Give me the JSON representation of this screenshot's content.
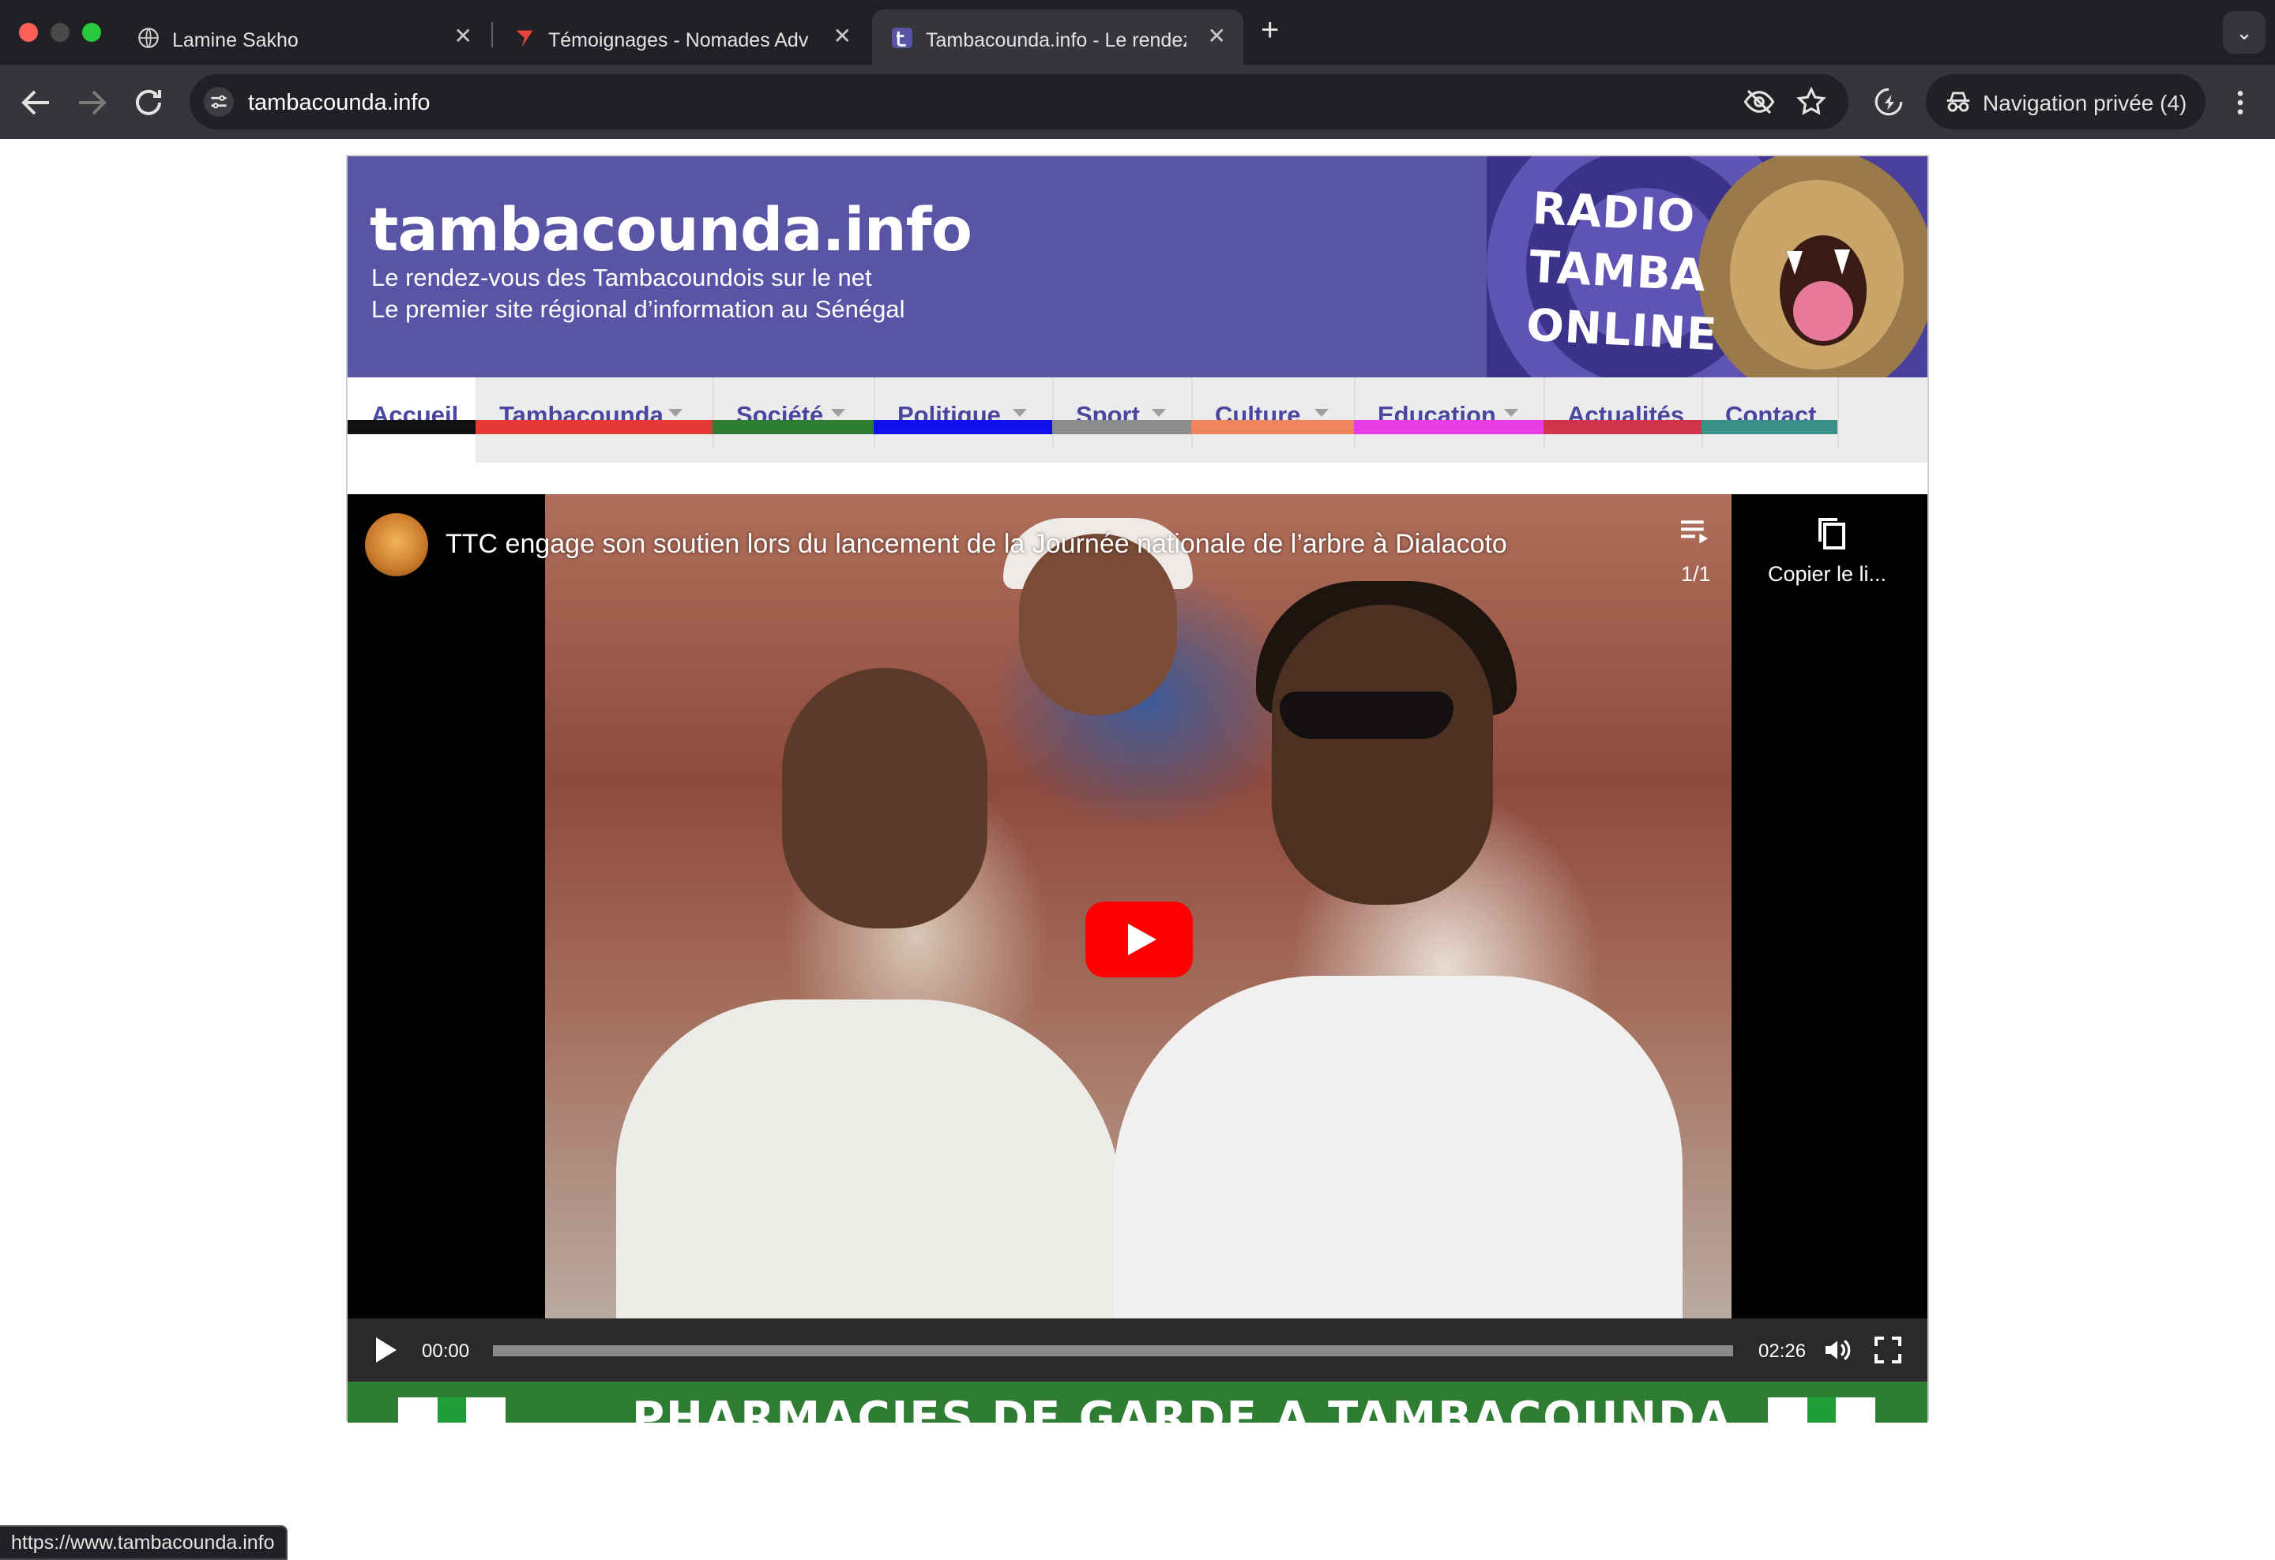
{
  "browser": {
    "tabs": [
      {
        "title": "Lamine Sakho",
        "favicon": "globe-icon",
        "active": false
      },
      {
        "title": "Témoignages - Nomades Adventure",
        "favicon": "nomades-icon",
        "active": false
      },
      {
        "title": "Tambacounda.info - Le rendez-vous des Tambacoundois",
        "favicon": "tambacounda-icon",
        "active": true
      }
    ],
    "close_glyph": "✕",
    "new_tab_glyph": "+",
    "tab_search_glyph": "⌄",
    "url": "tambacounda.info",
    "incognito_label": "Navigation privée (4)",
    "status_url": "https://www.tambacounda.info"
  },
  "site": {
    "title": "tambacounda.info",
    "tagline_1": "Le rendez-vous des Tambacoundois sur le net",
    "tagline_2": "Le premier site régional d’information au Sénégal",
    "radio_lines": [
      "RADIO",
      "TAMBA",
      "ONLINE"
    ],
    "nav": [
      {
        "label": "Accueil",
        "color": "#111111",
        "dropdown": false,
        "active": true
      },
      {
        "label": "Tambacounda",
        "color": "#e53935",
        "dropdown": true,
        "active": false
      },
      {
        "label": "Société",
        "color": "#2e7d32",
        "dropdown": true,
        "active": false
      },
      {
        "label": "Politique",
        "color": "#1010ee",
        "dropdown": true,
        "active": false
      },
      {
        "label": "Sport",
        "color": "#8c8c8c",
        "dropdown": true,
        "active": false
      },
      {
        "label": "Culture",
        "color": "#f0845c",
        "dropdown": true,
        "active": false
      },
      {
        "label": "Education",
        "color": "#e83ce6",
        "dropdown": true,
        "active": false
      },
      {
        "label": "Actualités",
        "color": "#d0334a",
        "dropdown": false,
        "active": false
      },
      {
        "label": "Contact",
        "color": "#3a8f86",
        "dropdown": false,
        "active": false
      }
    ],
    "accent_color": "#5a54a6"
  },
  "video": {
    "title": "TTC engage son soutien lors du lancement de la Journée nationale de l’arbre à Dialacoto",
    "playlist_count": "1/1",
    "copy_label": "Copier le li...",
    "current_time": "00:00",
    "total_time": "02:26",
    "progress": 0
  },
  "pharmacy": {
    "title": "PHARMACIES DE GARDE A TAMBACOUNDA"
  }
}
